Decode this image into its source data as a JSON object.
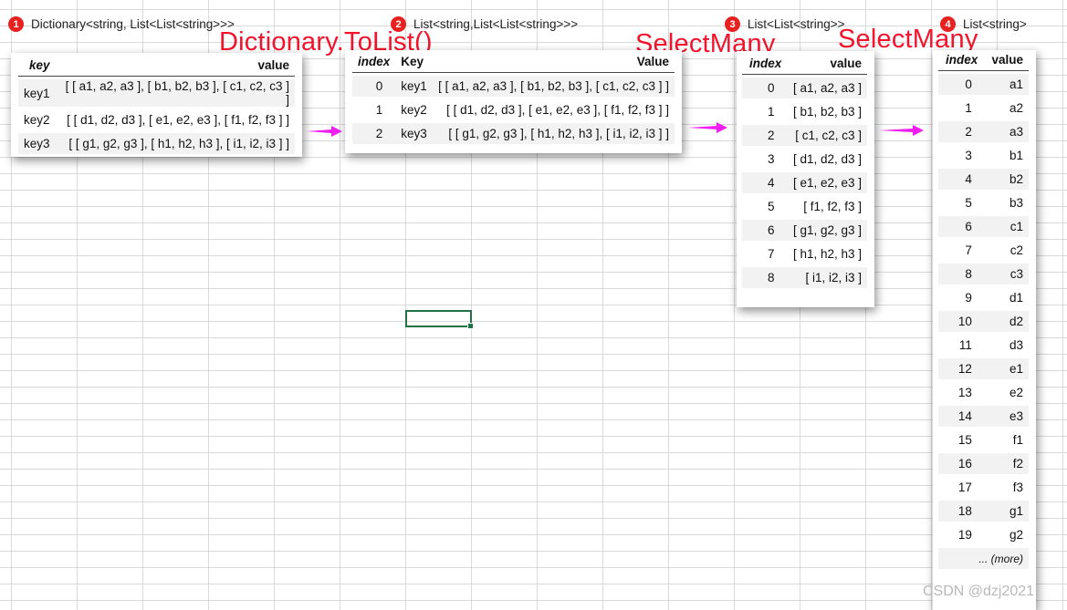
{
  "colors": {
    "badge": "#e8201f",
    "operation": "#f2142c",
    "arrow": "#f01ef0",
    "selection": "#217346"
  },
  "steps": [
    {
      "badge": "1",
      "type": "Dictionary<string, List<List<string>>>",
      "headers": [
        "key",
        "value"
      ],
      "rows": [
        [
          "key1",
          "[ [ a1, a2, a3 ], [ b1, b2, b3 ], [ c1, c2, c3 ] ]"
        ],
        [
          "key2",
          "[ [ d1, d2, d3 ], [ e1, e2, e3 ], [ f1, f2, f3 ] ]"
        ],
        [
          "key3",
          "[ [ g1, g2, g3 ], [ h1, h2, h3 ], [ i1, i2, i3 ] ]"
        ]
      ]
    },
    {
      "badge": "2",
      "type": "List<string,List<List<string>>>",
      "headers": [
        "index",
        "Key",
        "Value"
      ],
      "rows": [
        [
          "0",
          "key1",
          "[ [ a1, a2, a3 ], [ b1, b2, b3 ], [ c1, c2, c3 ] ]"
        ],
        [
          "1",
          "key2",
          "[ [ d1, d2, d3 ], [ e1, e2, e3 ], [ f1, f2, f3 ] ]"
        ],
        [
          "2",
          "key3",
          "[ [ g1, g2, g3 ], [ h1, h2, h3 ], [ i1, i2, i3 ] ]"
        ]
      ]
    },
    {
      "badge": "3",
      "type": "List<List<string>>",
      "headers": [
        "index",
        "value"
      ],
      "rows": [
        [
          "0",
          "[ a1, a2, a3 ]"
        ],
        [
          "1",
          "[ b1, b2, b3 ]"
        ],
        [
          "2",
          "[ c1, c2, c3 ]"
        ],
        [
          "3",
          "[ d1, d2, d3 ]"
        ],
        [
          "4",
          "[ e1, e2, e3 ]"
        ],
        [
          "5",
          "[ f1, f2, f3 ]"
        ],
        [
          "6",
          "[ g1, g2, g3 ]"
        ],
        [
          "7",
          "[ h1, h2, h3 ]"
        ],
        [
          "8",
          "[ i1, i2, i3 ]"
        ]
      ]
    },
    {
      "badge": "4",
      "type": "List<string>",
      "headers": [
        "index",
        "value"
      ],
      "rows": [
        [
          "0",
          "a1"
        ],
        [
          "1",
          "a2"
        ],
        [
          "2",
          "a3"
        ],
        [
          "3",
          "b1"
        ],
        [
          "4",
          "b2"
        ],
        [
          "5",
          "b3"
        ],
        [
          "6",
          "c1"
        ],
        [
          "7",
          "c2"
        ],
        [
          "8",
          "c3"
        ],
        [
          "9",
          "d1"
        ],
        [
          "10",
          "d2"
        ],
        [
          "11",
          "d3"
        ],
        [
          "12",
          "e1"
        ],
        [
          "13",
          "e2"
        ],
        [
          "14",
          "e3"
        ],
        [
          "15",
          "f1"
        ],
        [
          "16",
          "f2"
        ],
        [
          "17",
          "f3"
        ],
        [
          "18",
          "g1"
        ],
        [
          "19",
          "g2"
        ]
      ],
      "more": "... (more)"
    }
  ],
  "operations": [
    "Dictionary.ToList()",
    "SelectMany",
    "SelectMany"
  ],
  "watermark": "CSDN @dzj2021"
}
